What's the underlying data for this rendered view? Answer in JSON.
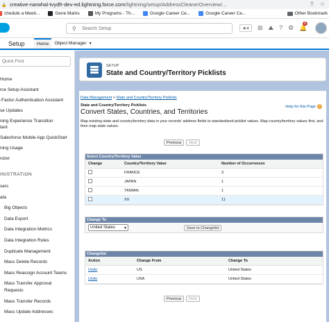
{
  "browser": {
    "url_host": "creative-narwhal-tvydfr-dev-ed.lightning.force.com",
    "url_path": "/lightning/setup/AddressCleanerOverview/...",
    "bookmarks": [
      {
        "label": "chedule a Meeti...",
        "color": "#e74c3c"
      },
      {
        "label": "Gene Marks",
        "color": "#202124"
      },
      {
        "label": "My Programs - Th...",
        "color": "#555555"
      },
      {
        "label": "Google Career Ce...",
        "color": "#4285f4"
      },
      {
        "label": "Google Career Ce...",
        "color": "#4285f4"
      }
    ],
    "other_bookmarks": "Other Bookmark"
  },
  "header": {
    "search_placeholder": "Search Setup",
    "notification_count": "6"
  },
  "appbar": {
    "app_name": "Setup",
    "tabs": [
      {
        "label": "Home",
        "active": true
      },
      {
        "label": "Object Manager",
        "active": false
      }
    ]
  },
  "sidebar": {
    "quick_find_placeholder": "Quick Find",
    "items": [
      {
        "label": "Home",
        "indent": false
      },
      {
        "label": "rce Setup Assistant",
        "indent": false
      },
      {
        "label": "-Factor Authentication Assistant",
        "indent": false
      },
      {
        "label": "se Updates",
        "indent": false
      },
      {
        "label": "ning Experience Transition",
        "indent": false
      },
      {
        "label": "tant",
        "indent": false
      },
      {
        "label": "Salesforce Mobile App QuickStart",
        "indent": false
      },
      {
        "label": "ning Usage",
        "indent": false
      },
      {
        "label": "nizer",
        "indent": false
      }
    ],
    "section": "INISTRATION",
    "section_items": [
      {
        "label": "sers"
      },
      {
        "label": "ata"
      }
    ],
    "sub_items": [
      "Big Objects",
      "Data Export",
      "Data Integration Metrics",
      "Data Integration Rules",
      "Duplicate Management",
      "Mass Delete Records",
      "Mass Reassign Account Teams",
      "Mass Transfer Approval",
      "Requests",
      "Mass Transfer Records",
      "Mass Update Addresses"
    ]
  },
  "page_header": {
    "eyebrow": "SETUP",
    "title": "State and Country/Territory Picklists"
  },
  "content": {
    "breadcrumb_1": "Data Management",
    "breadcrumb_sep": " > ",
    "breadcrumb_2": "State and Country/Territory Picklists",
    "subhead": "State and Country/Territory Picklists",
    "title": "Convert States, Countries, and Territories",
    "help": "Help for this Page",
    "description": "Map existing state and country/territory data in your records' address fields to standardized picklist values. Map country/territory values first, and then map state values.",
    "previous": "Previous",
    "next": "Next"
  },
  "select_block": {
    "title": "Select Country/Territory Value",
    "columns": [
      "Change",
      "Country/Territory Value",
      "Number of Occurrences"
    ],
    "rows": [
      {
        "value": "FRANCE",
        "count": "3",
        "highlight": false
      },
      {
        "value": "JAPAN",
        "count": "1",
        "highlight": false
      },
      {
        "value": "TAIWAN",
        "count": "1",
        "highlight": false
      },
      {
        "value": "XX",
        "count": "11",
        "highlight": true
      }
    ]
  },
  "change_block": {
    "title": "Change To",
    "selected": "United States",
    "save_button": "Save to Changelist"
  },
  "changelist": {
    "title": "Changelist",
    "columns": [
      "Action",
      "Change From",
      "Change To"
    ],
    "rows": [
      {
        "action": "Undo",
        "from": "US",
        "to": "United States"
      },
      {
        "action": "Undo",
        "from": "USA",
        "to": "United States"
      }
    ]
  }
}
